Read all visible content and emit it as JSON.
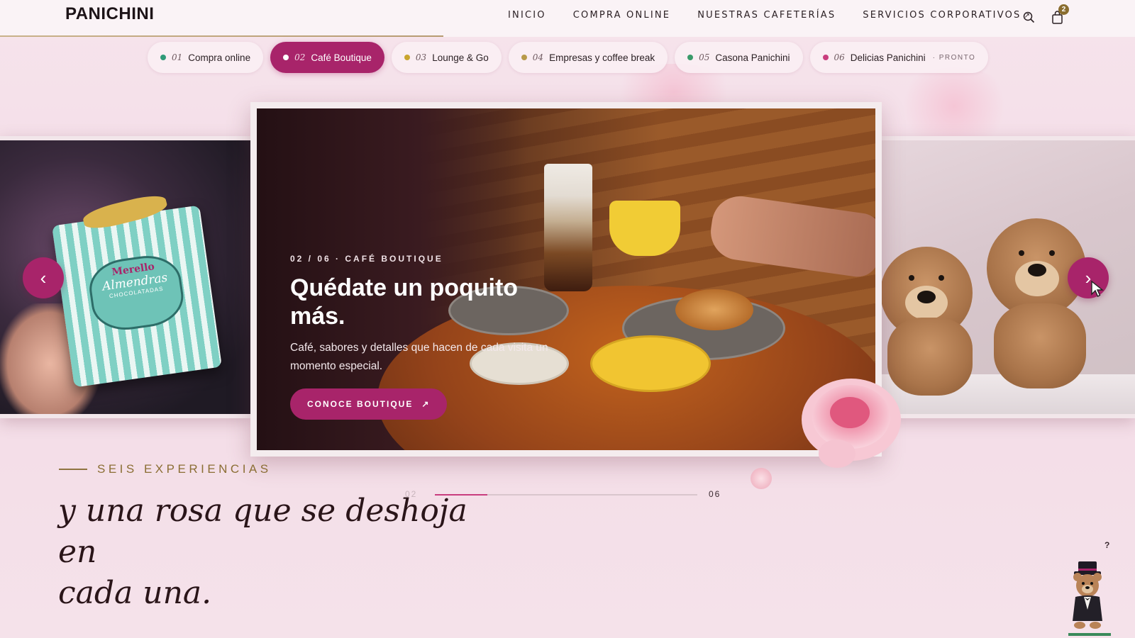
{
  "brand": {
    "logo": "PANICHINI"
  },
  "nav": {
    "items": [
      {
        "label": "INICIO"
      },
      {
        "label": "COMPRA ONLINE"
      },
      {
        "label": "NUESTRAS CAFETERÍAS"
      },
      {
        "label": "SERVICIOS CORPORATIVOS",
        "arrow": "↗"
      }
    ],
    "search_icon": "search-icon",
    "cart_icon": "shopping-bag-icon",
    "cart_count": "2"
  },
  "chips": [
    {
      "num": "01",
      "label": "Compra online",
      "dot": "#2f9a78",
      "active": false
    },
    {
      "num": "02",
      "label": "Café Boutique",
      "dot": "#ffffff",
      "active": true
    },
    {
      "num": "03",
      "label": "Lounge & Go",
      "dot": "#c9a52f",
      "active": false
    },
    {
      "num": "04",
      "label": "Empresas y coffee break",
      "dot": "#b89a4a",
      "active": false
    },
    {
      "num": "05",
      "label": "Casona Panichini",
      "dot": "#3a9a6a",
      "active": false
    },
    {
      "num": "06",
      "label": "Delicias Panichini",
      "dot": "#c93d7e",
      "active": false,
      "tag": "· PRONTO"
    }
  ],
  "slide": {
    "eyebrow": "02 / 06 · CAFÉ BOUTIQUE",
    "headline_line1": "Quédate un poquito",
    "headline_line2": "más.",
    "subcopy": "Café, sabores y detalles que hacen de cada visita un momento especial.",
    "cta_label": "CONOCE BOUTIQUE",
    "cta_arrow": "↗"
  },
  "side_left": {
    "box_brand": "Merello",
    "box_text": "Almendras",
    "box_sub": "CHOCOLATADAS"
  },
  "arrows": {
    "prev": "‹",
    "next": "›"
  },
  "section": {
    "label": "SEIS EXPERIENCIAS",
    "tagline_line1": "y una rosa que se deshoja en",
    "tagline_line2": "cada una."
  },
  "progress": {
    "current": "02",
    "total": "06",
    "fraction": 0.2
  },
  "colors": {
    "accent": "#a8246a",
    "gold": "#8b6e34",
    "background": "#f5e2ea"
  },
  "help": {
    "glyph": "?"
  }
}
